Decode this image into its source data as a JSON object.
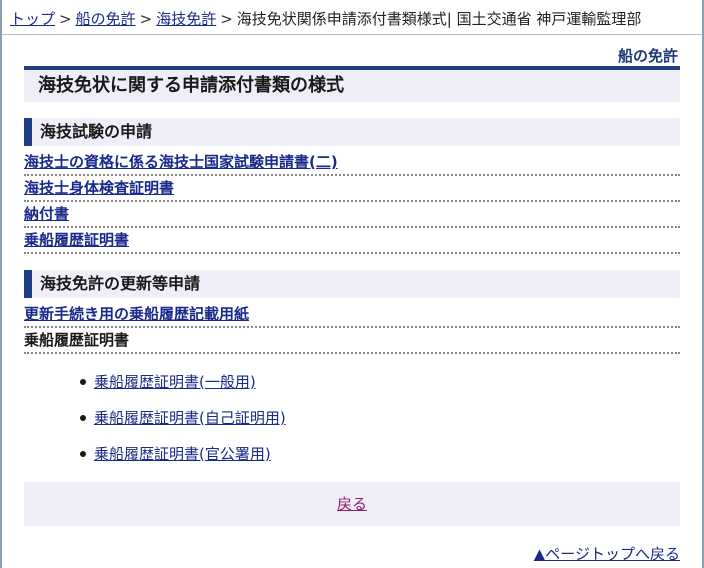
{
  "breadcrumb": {
    "items": [
      "トップ",
      "船の免許",
      "海技免許"
    ],
    "separator": ">",
    "current": "海技免状関係申請添付書類様式| 国土交通省 神戸運輸監理部"
  },
  "section_label": "船の免許",
  "page_title": "海技免状に関する申請添付書類の様式",
  "sections": [
    {
      "heading": "海技試験の申請",
      "links": [
        "海技士の資格に係る海技士国家試験申請書(二)",
        "海技士身体検査証明書",
        "納付書",
        "乗船履歴証明書"
      ]
    },
    {
      "heading": "海技免許の更新等申請",
      "links": [
        "更新手続き用の乗船履歴記載用紙"
      ],
      "plain_item": "乗船履歴証明書",
      "sub_links": [
        "乗船履歴証明書(一般用)",
        "乗船履歴証明書(自己証明用)",
        "乗船履歴証明書(官公署用)"
      ]
    }
  ],
  "back_label": "戻る",
  "page_top_label": "▲ページトップへ戻る",
  "colors": {
    "accent": "#1f3e86",
    "panel": "#eeeef9",
    "link": "#1a2a8c",
    "visited": "#8a1c6a"
  }
}
